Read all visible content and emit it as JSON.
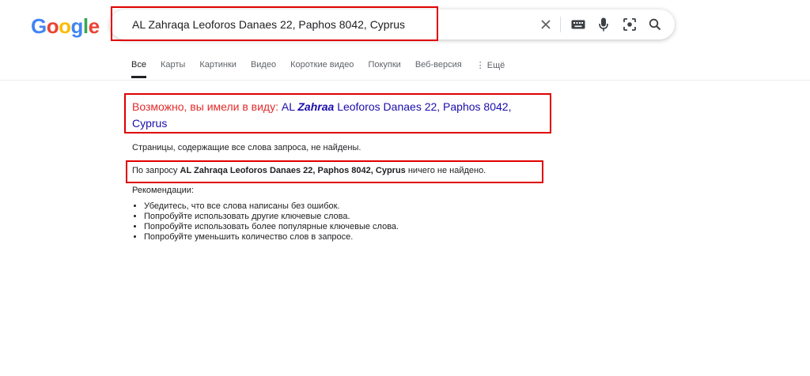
{
  "logo": [
    "G",
    "o",
    "o",
    "g",
    "l",
    "e"
  ],
  "logo_colors": [
    "#4285F4",
    "#EA4335",
    "#FBBC05",
    "#4285F4",
    "#34A853",
    "#EA4335"
  ],
  "search": {
    "query": "AL Zahraqa Leoforos Danaes 22, Paphos 8042, Cyprus"
  },
  "icons": [
    "close-icon",
    "keyboard-icon",
    "microphone-icon",
    "lens-icon",
    "search-icon"
  ],
  "tabs": [
    "Все",
    "Карты",
    "Картинки",
    "Видео",
    "Короткие видео",
    "Покупки",
    "Веб-версия",
    "Ещё"
  ],
  "tabs_more_glyph": "⋮",
  "suggestion": {
    "label": "Возможно, вы имели в виду:",
    "part1": "AL",
    "bold": "Zahraa",
    "part2": "Leoforos Danaes 22, Paphos 8042, Cyprus"
  },
  "no_pages": "Страницы, содержащие все слова запроса, не найдены.",
  "no_results": {
    "prefix": "По запросу",
    "query": "AL Zahraqa Leoforos Danaes 22, Paphos 8042, Cyprus",
    "suffix": "ничего не найдено."
  },
  "recommendations": {
    "title": "Рекомендации:",
    "items": [
      "Убедитесь, что все слова написаны без ошибок.",
      "Попробуйте использовать другие ключевые слова.",
      "Попробуйте использовать более популярные ключевые слова.",
      "Попробуйте уменьшить количество слов в запросе."
    ]
  },
  "colors": {
    "highlight": "#e00000",
    "link": "#1a0dab",
    "suggest_label": "#e32b2b"
  }
}
